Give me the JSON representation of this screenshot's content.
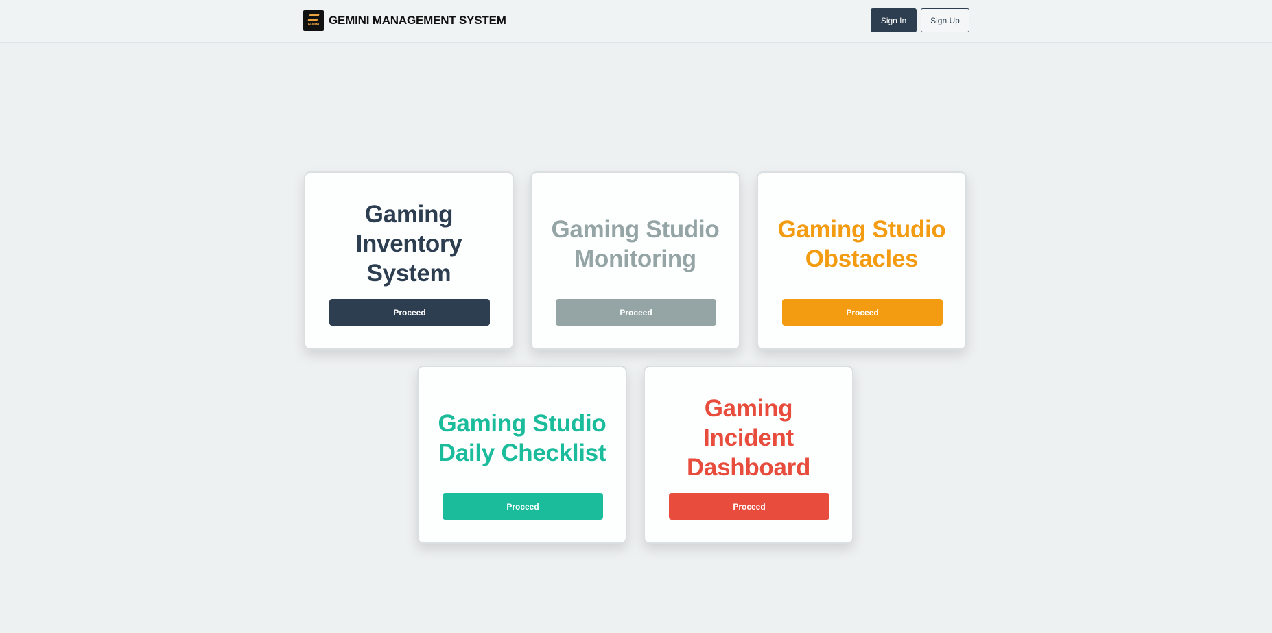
{
  "header": {
    "logo": {
      "icon": "gemini-logo-icon",
      "text": "GEMINI"
    },
    "title": "GEMINI MANAGEMENT SYSTEM",
    "sign_in_label": "Sign In",
    "sign_up_label": "Sign Up"
  },
  "cards": [
    {
      "title": "Gaming Inventory System",
      "button_label": "Proceed",
      "color": "#2d3e50"
    },
    {
      "title": "Gaming Studio Monitoring",
      "button_label": "Proceed",
      "color": "#95a5a6"
    },
    {
      "title": "Gaming Studio Obstacles",
      "button_label": "Proceed",
      "color": "#f39c12"
    },
    {
      "title": "Gaming Studio Daily Checklist",
      "button_label": "Proceed",
      "color": "#1abc9c"
    },
    {
      "title": "Gaming Incident Dashboard",
      "button_label": "Proceed",
      "color": "#e74c3c"
    }
  ]
}
